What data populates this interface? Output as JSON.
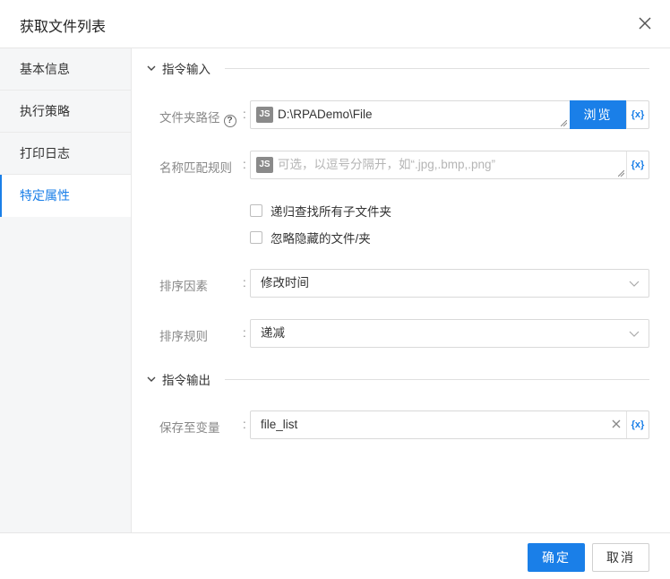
{
  "dialog": {
    "title": "获取文件列表",
    "close_icon": "close-icon"
  },
  "sidebar": {
    "items": [
      {
        "label": "基本信息",
        "active": false
      },
      {
        "label": "执行策略",
        "active": false
      },
      {
        "label": "打印日志",
        "active": false
      },
      {
        "label": "特定属性",
        "active": true
      }
    ]
  },
  "input_section": {
    "title": "指令输入",
    "folder_path": {
      "label": "文件夹路径",
      "help_icon": "?",
      "colon": ":",
      "badge": "JS",
      "value": "D:\\RPADemo\\File",
      "browse_label": "浏览",
      "var_label": "{x}"
    },
    "name_rule": {
      "label": "名称匹配规则",
      "colon": ":",
      "badge": "JS",
      "placeholder": "可选，以逗号分隔开，如“.jpg,.bmp,.png”",
      "var_label": "{x}"
    },
    "recursive": {
      "label": "递归查找所有子文件夹",
      "checked": false
    },
    "ignore_hidden": {
      "label": "忽略隐藏的文件/夹",
      "checked": false
    },
    "sort_factor": {
      "label": "排序因素",
      "colon": ":",
      "value": "修改时间"
    },
    "sort_rule": {
      "label": "排序规则",
      "colon": ":",
      "value": "递减"
    }
  },
  "output_section": {
    "title": "指令输出",
    "save_var": {
      "label": "保存至变量",
      "colon": ":",
      "value": "file_list",
      "var_label": "{x}"
    }
  },
  "footer": {
    "ok_label": "确定",
    "cancel_label": "取消"
  },
  "colors": {
    "accent": "#1a7fe8",
    "sidebar_bg": "#f5f6f7",
    "border": "#d9d9d9"
  }
}
